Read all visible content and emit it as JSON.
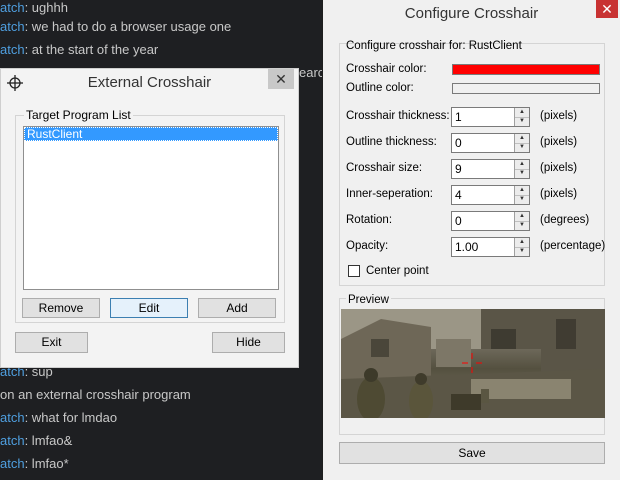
{
  "chat": {
    "lines": [
      {
        "name": "atch",
        "text": ": ughhh"
      },
      {
        "name": "atch",
        "text": ": we had to do a browser usage one"
      },
      {
        "name": "atch",
        "text": ": at the start of the year"
      },
      {
        "name": "",
        "text": "earch"
      },
      {
        "name": "atch",
        "text": ": sup"
      },
      {
        "name": "",
        "text": "on an external crosshair program"
      },
      {
        "name": "atch",
        "text": ": what for lmdao"
      },
      {
        "name": "atch",
        "text": ": lmfao&"
      },
      {
        "name": "atch",
        "text": ": lmfao*"
      }
    ]
  },
  "external": {
    "title": "External Crosshair",
    "close": "✕",
    "group_title": "Target Program List",
    "list_items": [
      "RustClient"
    ],
    "remove_label": "Remove",
    "edit_label": "Edit",
    "add_label": "Add",
    "exit_label": "Exit",
    "hide_label": "Hide"
  },
  "configure": {
    "title": "Configure Crosshair",
    "close": "✕",
    "for_label": "Configure crosshair for: RustClient",
    "crosshair_color_label": "Crosshair color:",
    "outline_color_label": "Outline color:",
    "crosshair_color": "#ff0000",
    "outline_color": "#f0f0f0",
    "fields": [
      {
        "label": "Crosshair thickness:",
        "value": "1",
        "unit": "(pixels)"
      },
      {
        "label": "Outline thickness:",
        "value": "0",
        "unit": "(pixels)"
      },
      {
        "label": "Crosshair size:",
        "value": "9",
        "unit": "(pixels)"
      },
      {
        "label": "Inner-seperation:",
        "value": "4",
        "unit": "(pixels)"
      },
      {
        "label": "Rotation:",
        "value": "0",
        "unit": "(degrees)"
      },
      {
        "label": "Opacity:",
        "value": "1.00",
        "unit": "(percentage)"
      }
    ],
    "center_point_label": "Center point",
    "center_point_checked": false,
    "preview_label": "Preview",
    "save_label": "Save"
  }
}
